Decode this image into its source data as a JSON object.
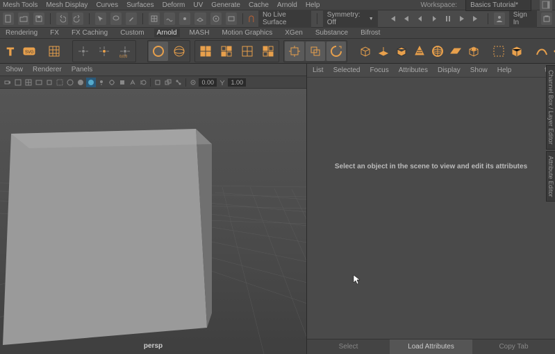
{
  "menubar": [
    "Mesh Tools",
    "Mesh Display",
    "Curves",
    "Surfaces",
    "Deform",
    "UV",
    "Generate",
    "Cache",
    "Arnold",
    "Help"
  ],
  "workspace": {
    "label": "Workspace:",
    "value": "Basics Tutorial*"
  },
  "topbar": {
    "no_live": "No Live Surface",
    "symmetry": "Symmetry: Off",
    "signin": "Sign In"
  },
  "shelves": [
    "Rendering",
    "FX",
    "FX Caching",
    "Custom",
    "Arnold",
    "MASH",
    "Motion Graphics",
    "XGen",
    "Substance",
    "Bifrost"
  ],
  "shelf_active": "Arnold",
  "viewport": {
    "menus": [
      "Show",
      "Renderer",
      "Panels"
    ],
    "camera": "persp",
    "val1": "0.00",
    "val2": "1.00"
  },
  "attr": {
    "menus": [
      "List",
      "Selected",
      "Focus",
      "Attributes",
      "Display",
      "Show",
      "Help"
    ],
    "empty": "Select an object in the scene to view and edit its attributes",
    "btn_select": "Select",
    "btn_load": "Load Attributes",
    "btn_copy": "Copy Tab"
  },
  "sidetabs": [
    "Channel Box / Layer Editor",
    "Attribute Editor"
  ]
}
